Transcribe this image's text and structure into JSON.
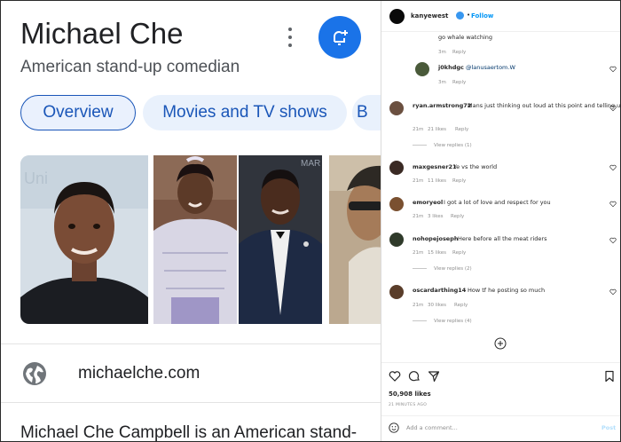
{
  "google": {
    "title": "Michael Che",
    "subtitle": "American stand-up comedian",
    "tabs": [
      {
        "label": "Overview"
      },
      {
        "label": "Movies and TV shows"
      },
      {
        "label": "B"
      }
    ],
    "photos_partial_text": {
      "p1": "Uni",
      "p3": "MAR"
    },
    "website": "michaelche.com",
    "description": "Michael Che Campbell is an American stand-",
    "colors": {
      "accent": "#1a73e8",
      "chip_text": "#1a56b8",
      "chip_bg": "#e9f1fc"
    },
    "icons": {
      "more": "more-vert-icon",
      "follow": "bell-add-icon",
      "website": "globe-icon"
    }
  },
  "instagram": {
    "username": "kanyewest",
    "dot": "•",
    "follow_label": "Follow",
    "comments": [
      {
        "text": "go whale watching",
        "time": "3m",
        "reply": "Reply"
      },
      {
        "user": "j0khdgc",
        "mention": "@lanusaertom.W",
        "time": "3m",
        "reply": "Reply"
      },
      {
        "user": "ryan.armstrong72",
        "text": "Mans just thinking out loud at this point and telling us",
        "time": "21m",
        "likes": "21 likes",
        "reply": "Reply",
        "view_replies": "View replies (1)"
      },
      {
        "user": "maxgesner21",
        "text": "Ye vs the world",
        "time": "21m",
        "likes": "11 likes",
        "reply": "Reply"
      },
      {
        "user": "emoryeol",
        "text": "I got a lot of love and respect for you",
        "time": "21m",
        "likes": "3 likes",
        "reply": "Reply"
      },
      {
        "user": "nohopejoseph",
        "text": "Here before all the meat riders",
        "time": "21m",
        "likes": "15 likes",
        "reply": "Reply",
        "view_replies": "View replies (2)"
      },
      {
        "user": "oscardarthing14",
        "text": "How tf he posting so much",
        "time": "21m",
        "likes": "30 likes",
        "reply": "Reply",
        "view_replies": "View replies (4)"
      }
    ],
    "likes": "50,908 likes",
    "ago": "21 MINUTES AGO",
    "add_comment_placeholder": "Add a comment...",
    "post_label": "Post",
    "colors": {
      "link": "#0095f6",
      "meta": "#8e8e8e",
      "text": "#262626"
    },
    "icons": [
      "heart-icon",
      "comment-icon",
      "share-icon",
      "bookmark-icon",
      "emoji-icon",
      "plus-circle-icon"
    ]
  }
}
